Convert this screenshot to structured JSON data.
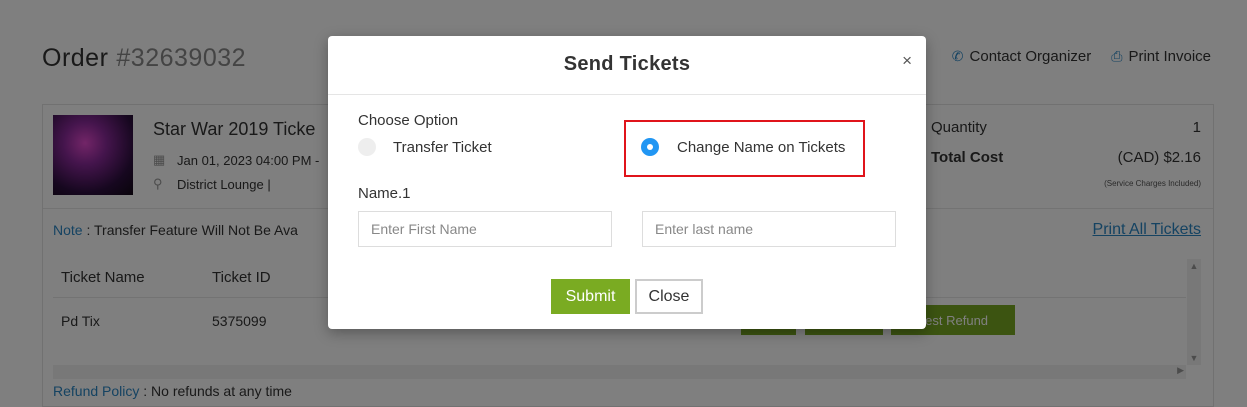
{
  "order": {
    "title": "Order",
    "number": "#32639032"
  },
  "top_links": {
    "contact": "Contact Organizer",
    "print_invoice": "Print Invoice"
  },
  "event": {
    "name": "Star War 2019 Ticke",
    "date": "Jan 01, 2023 04:00 PM -",
    "venue": "District Lounge |"
  },
  "summary": {
    "quantity_label": "Quantity",
    "quantity_value": "1",
    "total_label": "Total Cost",
    "total_value": "(CAD) $2.16",
    "service_note": "(Service Charges Included)"
  },
  "note": {
    "prefix": "Note",
    "text": " : Transfer Feature Will Not Be Ava"
  },
  "print_all": "Print All Tickets",
  "table": {
    "headers": [
      "Ticket Name",
      "Ticket ID"
    ],
    "rows": [
      {
        "name": "Pd Tix",
        "id": "5375099",
        "refund_button": "uest Refund"
      }
    ]
  },
  "refund": {
    "prefix": "Refund Policy",
    "text": " : No refunds at any time"
  },
  "modal": {
    "title": "Send Tickets",
    "close_glyph": "×",
    "choose_label": "Choose Option",
    "options": [
      {
        "label": "Transfer Ticket",
        "selected": false
      },
      {
        "label": "Change Name on Tickets",
        "selected": true
      }
    ],
    "name_label": "Name.1",
    "first_placeholder": "Enter First Name",
    "last_placeholder": "Enter last name",
    "submit_label": "Submit",
    "close_label": "Close"
  },
  "colors": {
    "accent_blue": "#2196f3",
    "link_blue": "#2a86c4",
    "submit_green": "#7aab22",
    "highlight_red": "#e0141b"
  },
  "icons": {
    "contact": "phone-icon",
    "print": "printer-icon",
    "date": "calendar-icon",
    "venue": "location-pin-icon"
  }
}
